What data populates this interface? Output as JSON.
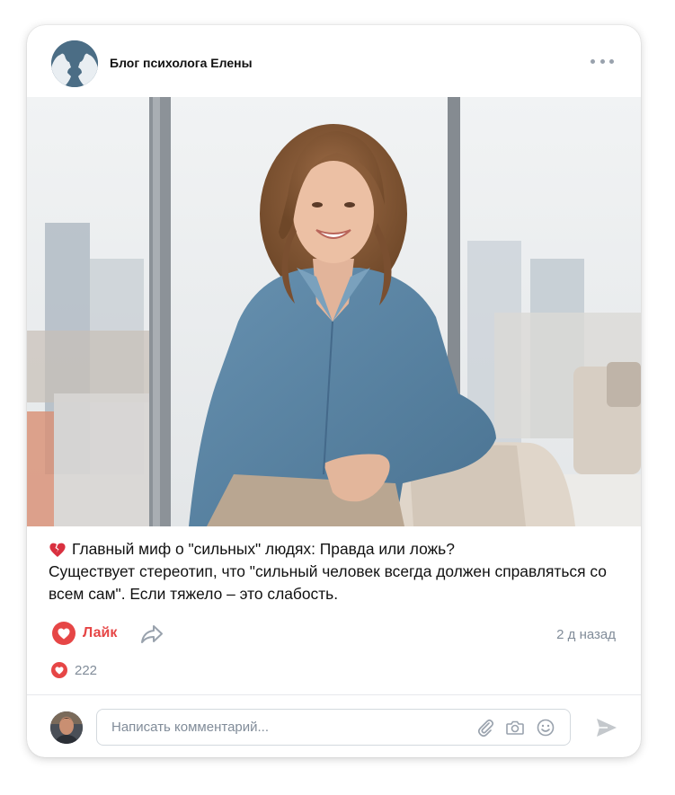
{
  "post": {
    "author": "Блог психолога Елены",
    "title_line": "Главный миф о \"сильных\" людях: Правда или ложь?",
    "body_line1": "Существует стереотип, что \"сильный человек всегда должен справляться со",
    "body_line2": "всем сам\". Если тяжело – это слабость.",
    "emoji": "broken-heart-icon"
  },
  "actions": {
    "like_label": "Лайк",
    "date": "2 д назад",
    "likes_count": "222"
  },
  "comment": {
    "placeholder": "Написать комментарий..."
  },
  "colors": {
    "accent_red": "#e64646",
    "secondary_text": "#818c99",
    "avatar_bg": "#4b6d85",
    "shirt": "#5a86a6"
  }
}
